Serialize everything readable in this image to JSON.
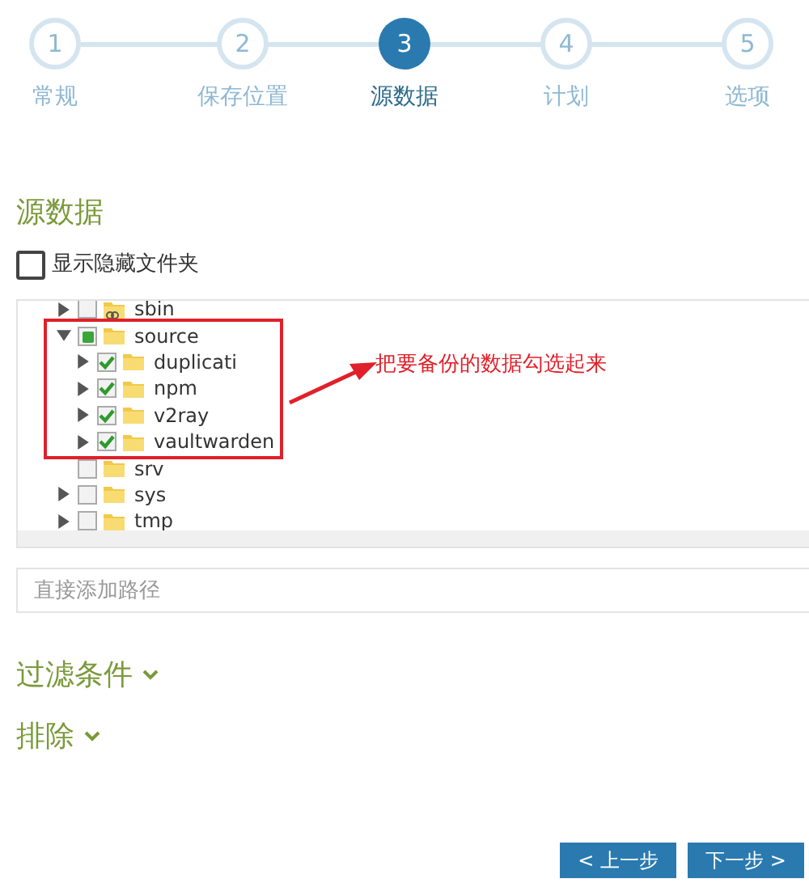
{
  "steps": [
    {
      "number": "1",
      "label": "常规",
      "selected": false
    },
    {
      "number": "2",
      "label": "保存位置",
      "selected": false
    },
    {
      "number": "3",
      "label": "源数据",
      "selected": true
    },
    {
      "number": "4",
      "label": "计划",
      "selected": false
    },
    {
      "number": "5",
      "label": "选项",
      "selected": false
    }
  ],
  "section_title": "源数据",
  "show_hidden": {
    "label": "显示隐藏文件夹",
    "checked": false
  },
  "tree": [
    {
      "name": "sbin",
      "kind": "branch",
      "expanded": false,
      "checked": false,
      "indeterminate": false,
      "link": true
    },
    {
      "name": "source",
      "kind": "branch",
      "expanded": true,
      "checked": false,
      "indeterminate": true,
      "children": [
        {
          "name": "duplicati",
          "kind": "branch",
          "expanded": false,
          "checked": true,
          "indeterminate": false
        },
        {
          "name": "npm",
          "kind": "branch",
          "expanded": false,
          "checked": true,
          "indeterminate": false
        },
        {
          "name": "v2ray",
          "kind": "branch",
          "expanded": false,
          "checked": true,
          "indeterminate": false
        },
        {
          "name": "vaultwarden",
          "kind": "branch",
          "expanded": false,
          "checked": true,
          "indeterminate": false
        }
      ]
    },
    {
      "name": "srv",
      "kind": "leaf",
      "checked": false,
      "indeterminate": false
    },
    {
      "name": "sys",
      "kind": "branch",
      "expanded": false,
      "checked": false,
      "indeterminate": false
    },
    {
      "name": "tmp",
      "kind": "branch",
      "expanded": false,
      "checked": false,
      "indeterminate": false
    }
  ],
  "annotation": "把要备份的数据勾选起来",
  "path_input": {
    "placeholder": "直接添加路径"
  },
  "collapsibles": [
    {
      "label": "过滤条件",
      "expanded": false
    },
    {
      "label": "排除",
      "expanded": false
    }
  ],
  "buttons": [
    "< 上一步",
    "下一步 >"
  ]
}
